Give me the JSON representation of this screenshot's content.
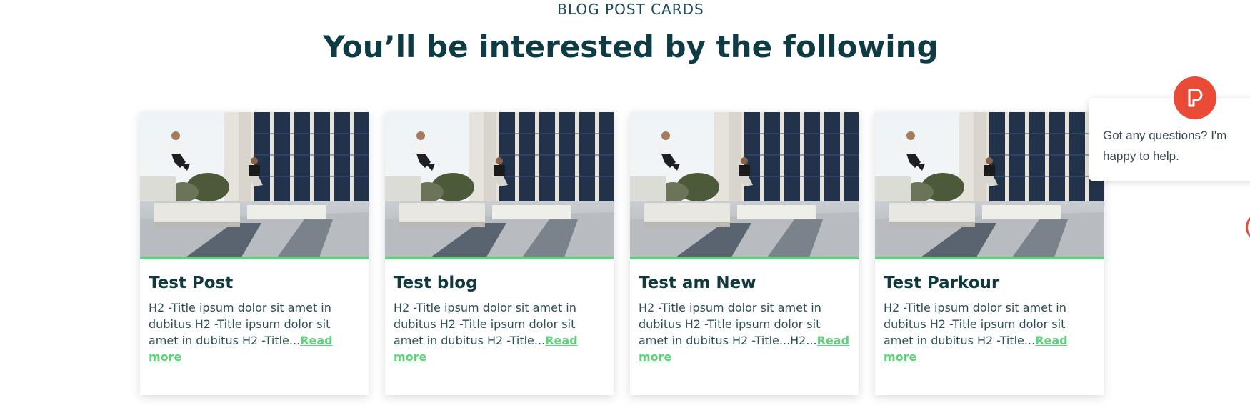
{
  "section": {
    "eyebrow": "BLOG POST CARDS",
    "headline": "You’ll be interested by the following"
  },
  "cards": [
    {
      "title": "Test Post",
      "excerpt": "H2 -Title ipsum dolor sit amet in dubitus H2 -Title ipsum dolor sit amet in dubitus H2 -Title...",
      "read_more": "Read more"
    },
    {
      "title": "Test blog",
      "excerpt": "H2 -Title ipsum dolor sit amet in dubitus H2 -Title ipsum dolor sit amet in dubitus H2 -Title...",
      "read_more": "Read more"
    },
    {
      "title": "Test am New",
      "excerpt": "H2 -Title ipsum dolor sit amet in dubitus H2 -Title ipsum dolor sit amet in dubitus H2 -Title...H2...",
      "read_more": "Read more"
    },
    {
      "title": "Test Parkour",
      "excerpt": "H2 -Title ipsum dolor sit amet in dubitus H2 -Title ipsum dolor sit amet in dubitus H2 -Title...",
      "read_more": "Read more"
    }
  ],
  "chat": {
    "message": "Got any questions? I'm happy to help.",
    "avatar_icon": "chat-logo-icon",
    "accent": "#ea4b36"
  },
  "colors": {
    "heading": "#0f3c44",
    "accent_green": "#5fd17c"
  }
}
